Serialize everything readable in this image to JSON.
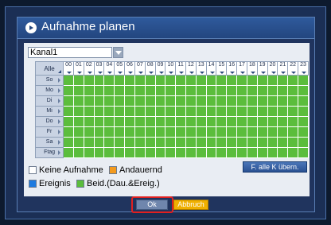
{
  "title": "Aufnahme planen",
  "channel": {
    "value": "Kanal1"
  },
  "grid": {
    "all_label": "Alle",
    "hours": [
      "00",
      "01",
      "02",
      "03",
      "04",
      "05",
      "06",
      "07",
      "08",
      "09",
      "10",
      "11",
      "12",
      "13",
      "14",
      "15",
      "16",
      "17",
      "18",
      "19",
      "20",
      "21",
      "22",
      "23"
    ],
    "days": [
      "So",
      "Mo",
      "Di",
      "Mi",
      "Do",
      "Fr",
      "Sa",
      "Ftag"
    ],
    "slot_mode": "Beid.(Dau.&Ereig.)"
  },
  "legend": {
    "none": "Keine Aufnahme",
    "continuous": "Andauernd",
    "event": "Ereignis",
    "both": "Beid.(Dau.&Ereig.)"
  },
  "colors": {
    "none": "#ffffff",
    "continuous": "#f39a1e",
    "event": "#1e7be0",
    "both": "#5bbd3c"
  },
  "copy_button": "F. alle K übern.",
  "buttons": {
    "ok": "Ok",
    "cancel": "Abbruch"
  }
}
